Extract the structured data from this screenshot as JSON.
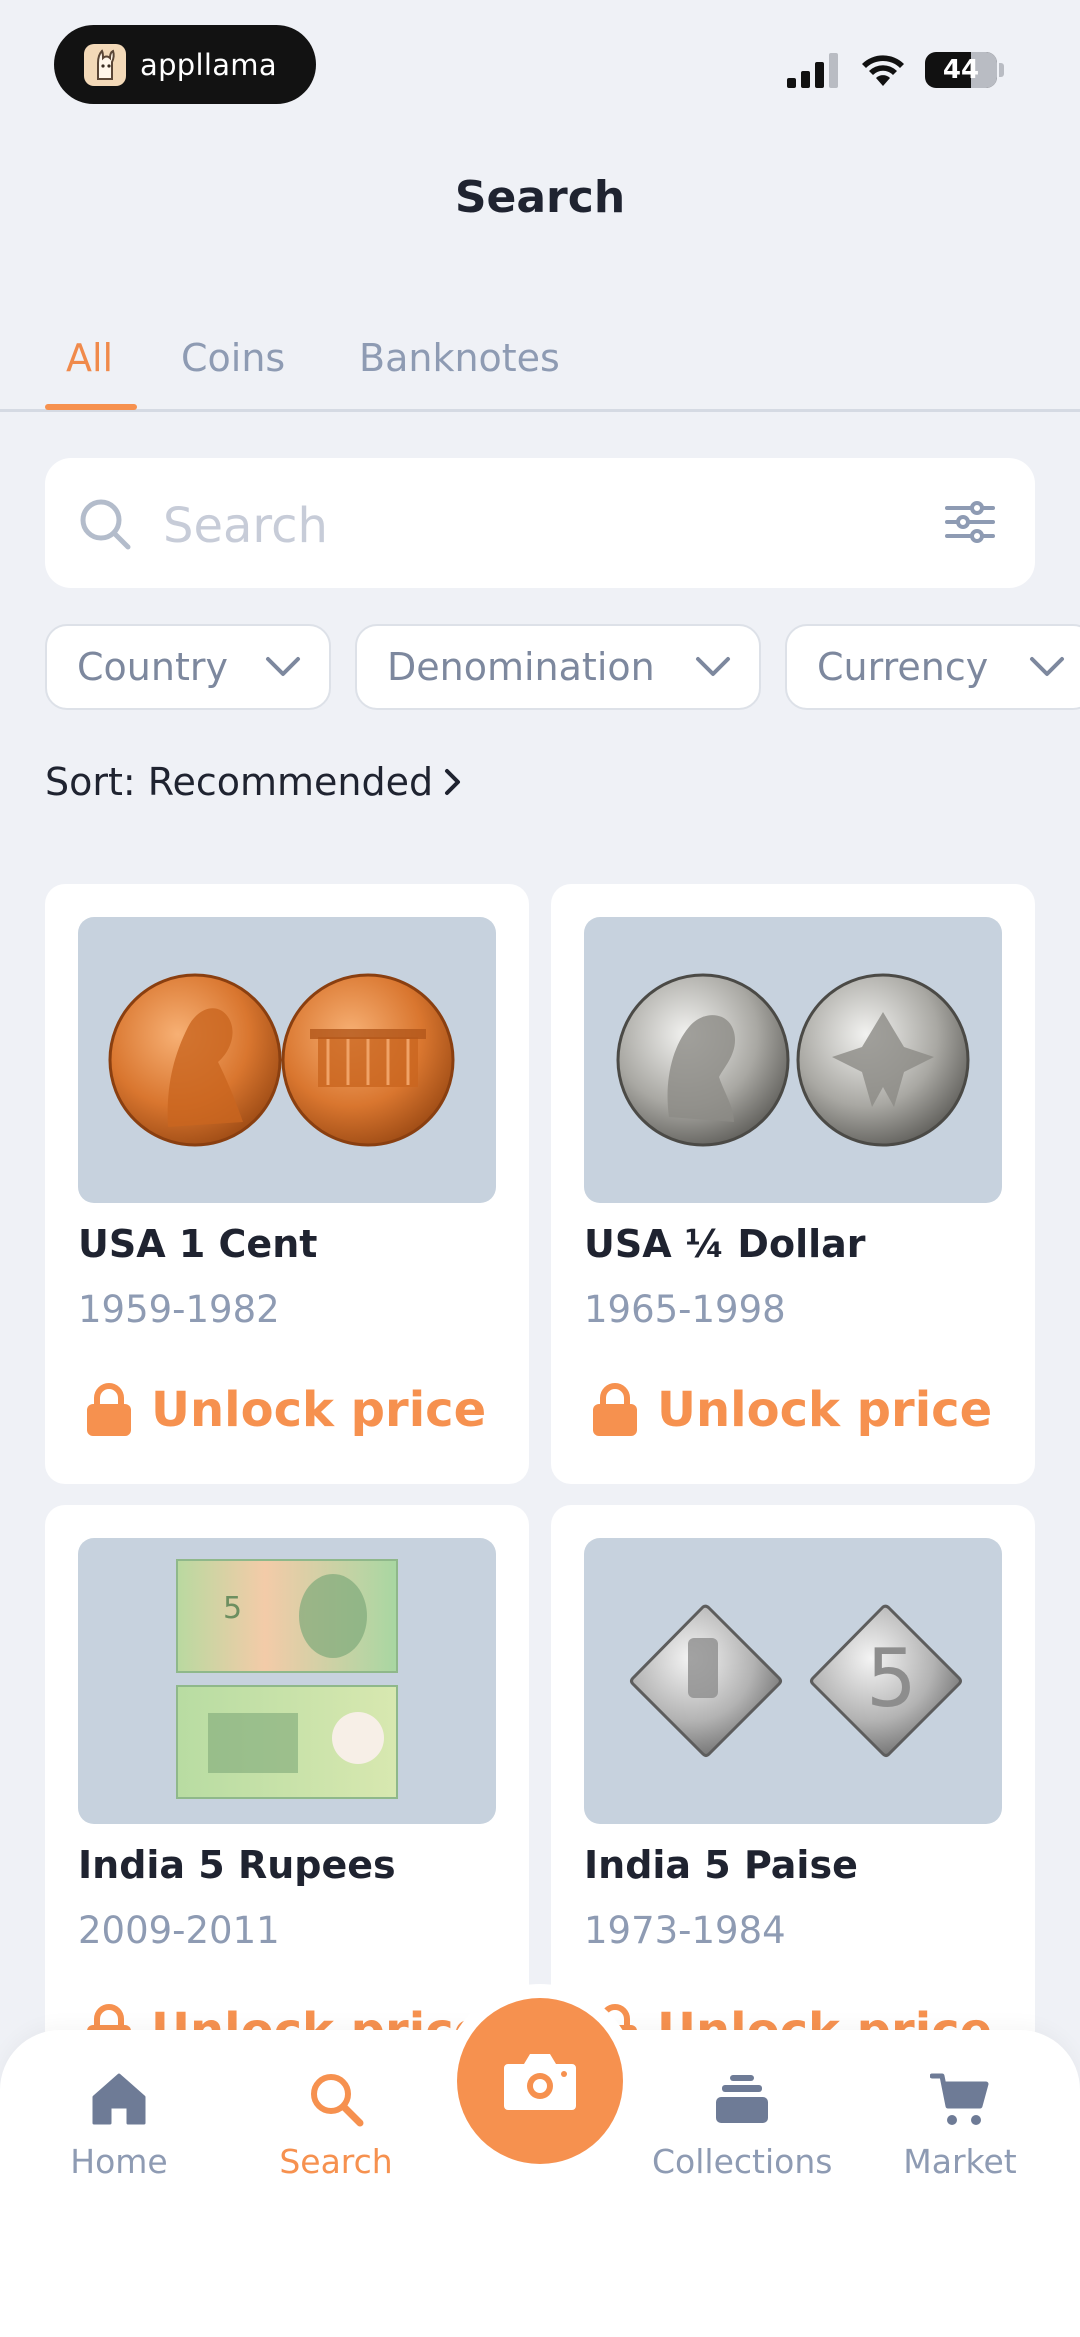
{
  "status_bar": {
    "app_name": "appllama",
    "battery": "44"
  },
  "header": {
    "title": "Search"
  },
  "tabs": [
    {
      "label": "All",
      "active": true
    },
    {
      "label": "Coins",
      "active": false
    },
    {
      "label": "Banknotes",
      "active": false
    }
  ],
  "search": {
    "placeholder": "Search"
  },
  "filters": [
    {
      "label": "Country"
    },
    {
      "label": "Denomination"
    },
    {
      "label": "Currency"
    }
  ],
  "sort": {
    "label": "Sort: Recommended"
  },
  "items": [
    {
      "title": "USA 1 Cent",
      "years": "1959-1982",
      "price_label": "Unlock price"
    },
    {
      "title": "USA ¼ Dollar",
      "years": "1965-1998",
      "price_label": "Unlock price"
    },
    {
      "title": "India 5 Rupees",
      "years": "2009-2011",
      "price_label": "Unlock price"
    },
    {
      "title": "India 5 Paise",
      "years": "1973-1984",
      "price_label": "Unlock price"
    }
  ],
  "bottom_nav": [
    {
      "label": "Home",
      "icon": "home-icon",
      "active": false
    },
    {
      "label": "Search",
      "icon": "search-icon",
      "active": true
    },
    {
      "label": "Collections",
      "icon": "stack-icon",
      "active": false
    },
    {
      "label": "Market",
      "icon": "cart-icon",
      "active": false
    }
  ],
  "camera": {
    "icon": "camera-icon"
  },
  "colors": {
    "accent": "#f6914f",
    "muted": "#8e9bb3",
    "background": "#eff1f6"
  }
}
